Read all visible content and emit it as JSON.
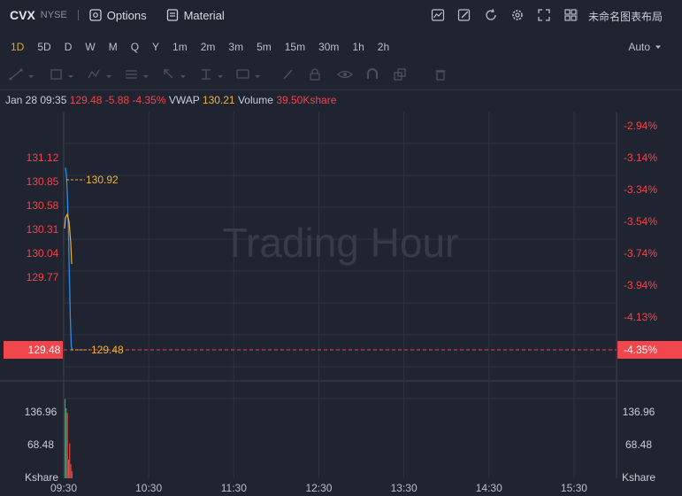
{
  "header": {
    "ticker": "CVX",
    "exchange": "NYSE",
    "options_label": "Options",
    "material_label": "Material",
    "layout_name": "未命名图表布局"
  },
  "timeframes": [
    "1D",
    "5D",
    "D",
    "W",
    "M",
    "Q",
    "Y",
    "1m",
    "2m",
    "3m",
    "5m",
    "15m",
    "30m",
    "1h",
    "2h"
  ],
  "active_timeframe": "1D",
  "scale_mode": "Auto",
  "legend": {
    "datetime": "Jan 28 09:35",
    "price": "129.48",
    "change": "-5.88",
    "change_pct": "-4.35%",
    "vwap_label": "VWAP",
    "vwap": "130.21",
    "volume_label": "Volume",
    "volume": "39.50Kshare"
  },
  "watermark": "Trading Hour",
  "chart_data": {
    "type": "line",
    "price_axis_left": [
      "131.12",
      "130.85",
      "130.58",
      "130.31",
      "130.04",
      "129.77"
    ],
    "price_axis_right": [
      "-2.94%",
      "-3.14%",
      "-3.34%",
      "-3.54%",
      "-3.74%",
      "-3.94%",
      "-4.13%"
    ],
    "current_price": "129.48",
    "current_pct": "-4.35%",
    "high_label": "130.92",
    "low_label": "129.48",
    "volume_axis": [
      "136.96",
      "68.48"
    ],
    "volume_unit": "Kshare",
    "time_axis": [
      "09:30",
      "10:30",
      "11:30",
      "12:30",
      "13:30",
      "14:30",
      "15:30"
    ],
    "price_range": [
      129.3,
      131.35
    ],
    "series": [
      {
        "name": "Price",
        "color": "#2f8de4",
        "values": [
          130.92,
          130.86,
          130.7,
          130.45,
          130.1,
          129.77,
          129.55,
          129.48
        ]
      },
      {
        "name": "VWAP",
        "color": "#f2b233",
        "values": [
          130.58,
          130.66,
          130.63,
          130.52,
          130.41,
          130.32
        ]
      }
    ],
    "volume_bars": [
      {
        "value": 170,
        "color": "#2cb05f"
      },
      {
        "value": 150,
        "color": "#2cb05f"
      },
      {
        "value": 140,
        "color": "#f0464c"
      },
      {
        "value": 40,
        "color": "#f0464c"
      },
      {
        "value": 75,
        "color": "#f0464c"
      },
      {
        "value": 30,
        "color": "#f0464c"
      },
      {
        "value": 15,
        "color": "#f0464c"
      }
    ],
    "volume_max": 205,
    "grid": true
  },
  "colors": {
    "accent": "#e0a43a",
    "down": "#f0464c",
    "up": "#2cb05f",
    "price_line": "#2f8de4",
    "vwap_line": "#f2b233"
  }
}
